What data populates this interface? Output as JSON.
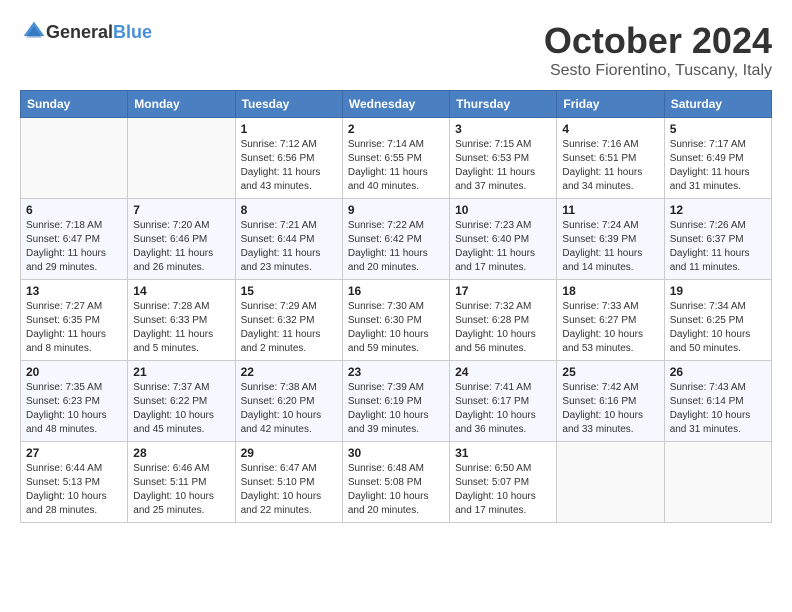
{
  "logo": {
    "text_general": "General",
    "text_blue": "Blue"
  },
  "header": {
    "month": "October 2024",
    "location": "Sesto Fiorentino, Tuscany, Italy"
  },
  "weekdays": [
    "Sunday",
    "Monday",
    "Tuesday",
    "Wednesday",
    "Thursday",
    "Friday",
    "Saturday"
  ],
  "weeks": [
    [
      {
        "day": "",
        "sunrise": "",
        "sunset": "",
        "daylight": ""
      },
      {
        "day": "",
        "sunrise": "",
        "sunset": "",
        "daylight": ""
      },
      {
        "day": "1",
        "sunrise": "Sunrise: 7:12 AM",
        "sunset": "Sunset: 6:56 PM",
        "daylight": "Daylight: 11 hours and 43 minutes."
      },
      {
        "day": "2",
        "sunrise": "Sunrise: 7:14 AM",
        "sunset": "Sunset: 6:55 PM",
        "daylight": "Daylight: 11 hours and 40 minutes."
      },
      {
        "day": "3",
        "sunrise": "Sunrise: 7:15 AM",
        "sunset": "Sunset: 6:53 PM",
        "daylight": "Daylight: 11 hours and 37 minutes."
      },
      {
        "day": "4",
        "sunrise": "Sunrise: 7:16 AM",
        "sunset": "Sunset: 6:51 PM",
        "daylight": "Daylight: 11 hours and 34 minutes."
      },
      {
        "day": "5",
        "sunrise": "Sunrise: 7:17 AM",
        "sunset": "Sunset: 6:49 PM",
        "daylight": "Daylight: 11 hours and 31 minutes."
      }
    ],
    [
      {
        "day": "6",
        "sunrise": "Sunrise: 7:18 AM",
        "sunset": "Sunset: 6:47 PM",
        "daylight": "Daylight: 11 hours and 29 minutes."
      },
      {
        "day": "7",
        "sunrise": "Sunrise: 7:20 AM",
        "sunset": "Sunset: 6:46 PM",
        "daylight": "Daylight: 11 hours and 26 minutes."
      },
      {
        "day": "8",
        "sunrise": "Sunrise: 7:21 AM",
        "sunset": "Sunset: 6:44 PM",
        "daylight": "Daylight: 11 hours and 23 minutes."
      },
      {
        "day": "9",
        "sunrise": "Sunrise: 7:22 AM",
        "sunset": "Sunset: 6:42 PM",
        "daylight": "Daylight: 11 hours and 20 minutes."
      },
      {
        "day": "10",
        "sunrise": "Sunrise: 7:23 AM",
        "sunset": "Sunset: 6:40 PM",
        "daylight": "Daylight: 11 hours and 17 minutes."
      },
      {
        "day": "11",
        "sunrise": "Sunrise: 7:24 AM",
        "sunset": "Sunset: 6:39 PM",
        "daylight": "Daylight: 11 hours and 14 minutes."
      },
      {
        "day": "12",
        "sunrise": "Sunrise: 7:26 AM",
        "sunset": "Sunset: 6:37 PM",
        "daylight": "Daylight: 11 hours and 11 minutes."
      }
    ],
    [
      {
        "day": "13",
        "sunrise": "Sunrise: 7:27 AM",
        "sunset": "Sunset: 6:35 PM",
        "daylight": "Daylight: 11 hours and 8 minutes."
      },
      {
        "day": "14",
        "sunrise": "Sunrise: 7:28 AM",
        "sunset": "Sunset: 6:33 PM",
        "daylight": "Daylight: 11 hours and 5 minutes."
      },
      {
        "day": "15",
        "sunrise": "Sunrise: 7:29 AM",
        "sunset": "Sunset: 6:32 PM",
        "daylight": "Daylight: 11 hours and 2 minutes."
      },
      {
        "day": "16",
        "sunrise": "Sunrise: 7:30 AM",
        "sunset": "Sunset: 6:30 PM",
        "daylight": "Daylight: 10 hours and 59 minutes."
      },
      {
        "day": "17",
        "sunrise": "Sunrise: 7:32 AM",
        "sunset": "Sunset: 6:28 PM",
        "daylight": "Daylight: 10 hours and 56 minutes."
      },
      {
        "day": "18",
        "sunrise": "Sunrise: 7:33 AM",
        "sunset": "Sunset: 6:27 PM",
        "daylight": "Daylight: 10 hours and 53 minutes."
      },
      {
        "day": "19",
        "sunrise": "Sunrise: 7:34 AM",
        "sunset": "Sunset: 6:25 PM",
        "daylight": "Daylight: 10 hours and 50 minutes."
      }
    ],
    [
      {
        "day": "20",
        "sunrise": "Sunrise: 7:35 AM",
        "sunset": "Sunset: 6:23 PM",
        "daylight": "Daylight: 10 hours and 48 minutes."
      },
      {
        "day": "21",
        "sunrise": "Sunrise: 7:37 AM",
        "sunset": "Sunset: 6:22 PM",
        "daylight": "Daylight: 10 hours and 45 minutes."
      },
      {
        "day": "22",
        "sunrise": "Sunrise: 7:38 AM",
        "sunset": "Sunset: 6:20 PM",
        "daylight": "Daylight: 10 hours and 42 minutes."
      },
      {
        "day": "23",
        "sunrise": "Sunrise: 7:39 AM",
        "sunset": "Sunset: 6:19 PM",
        "daylight": "Daylight: 10 hours and 39 minutes."
      },
      {
        "day": "24",
        "sunrise": "Sunrise: 7:41 AM",
        "sunset": "Sunset: 6:17 PM",
        "daylight": "Daylight: 10 hours and 36 minutes."
      },
      {
        "day": "25",
        "sunrise": "Sunrise: 7:42 AM",
        "sunset": "Sunset: 6:16 PM",
        "daylight": "Daylight: 10 hours and 33 minutes."
      },
      {
        "day": "26",
        "sunrise": "Sunrise: 7:43 AM",
        "sunset": "Sunset: 6:14 PM",
        "daylight": "Daylight: 10 hours and 31 minutes."
      }
    ],
    [
      {
        "day": "27",
        "sunrise": "Sunrise: 6:44 AM",
        "sunset": "Sunset: 5:13 PM",
        "daylight": "Daylight: 10 hours and 28 minutes."
      },
      {
        "day": "28",
        "sunrise": "Sunrise: 6:46 AM",
        "sunset": "Sunset: 5:11 PM",
        "daylight": "Daylight: 10 hours and 25 minutes."
      },
      {
        "day": "29",
        "sunrise": "Sunrise: 6:47 AM",
        "sunset": "Sunset: 5:10 PM",
        "daylight": "Daylight: 10 hours and 22 minutes."
      },
      {
        "day": "30",
        "sunrise": "Sunrise: 6:48 AM",
        "sunset": "Sunset: 5:08 PM",
        "daylight": "Daylight: 10 hours and 20 minutes."
      },
      {
        "day": "31",
        "sunrise": "Sunrise: 6:50 AM",
        "sunset": "Sunset: 5:07 PM",
        "daylight": "Daylight: 10 hours and 17 minutes."
      },
      {
        "day": "",
        "sunrise": "",
        "sunset": "",
        "daylight": ""
      },
      {
        "day": "",
        "sunrise": "",
        "sunset": "",
        "daylight": ""
      }
    ]
  ]
}
